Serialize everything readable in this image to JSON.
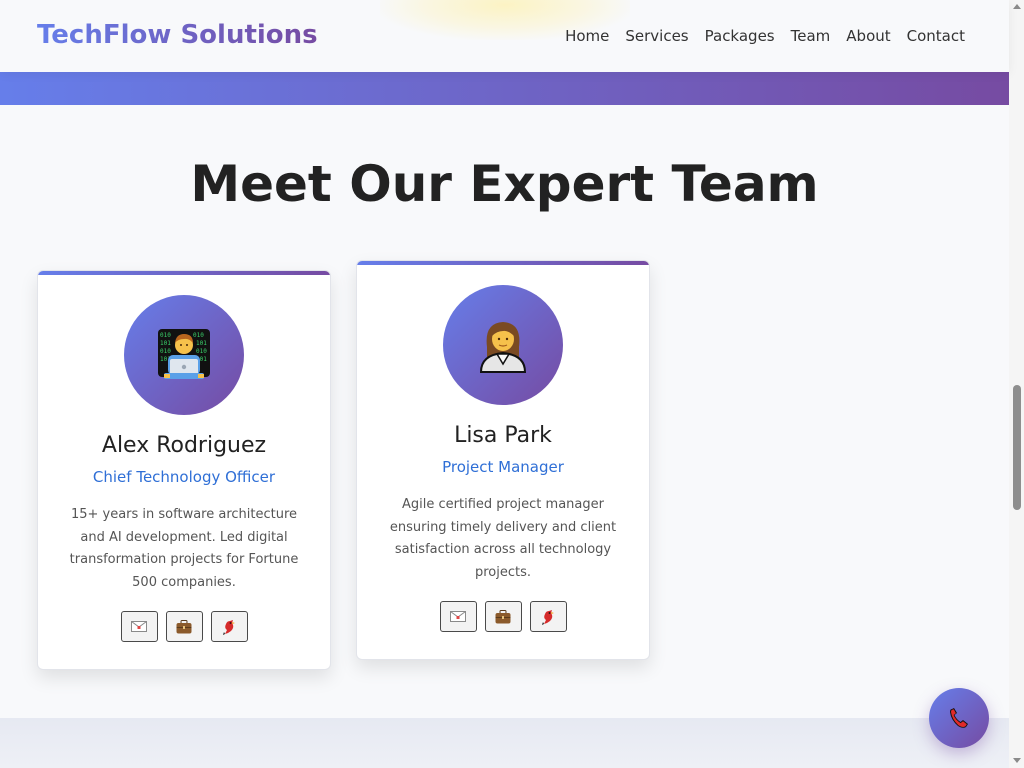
{
  "brand": {
    "name": "TechFlow Solutions"
  },
  "nav": {
    "items": [
      "Home",
      "Services",
      "Packages",
      "Team",
      "About",
      "Contact"
    ]
  },
  "team": {
    "title": "Meet Our Expert Team",
    "members": [
      {
        "avatar_icon": "technologist-icon",
        "name": "Alex Rodriguez",
        "role": "Chief Technology Officer",
        "bio": "15+ years in software architecture and AI development. Led digital transformation projects for Fortune 500 companies.",
        "social_icons": [
          "envelope-icon",
          "briefcase-icon",
          "bird-icon"
        ]
      },
      {
        "avatar_icon": "businesswoman-icon",
        "name": "Lisa Park",
        "role": "Project Manager",
        "bio": "Agile certified project manager ensuring timely delivery and client satisfaction across all technology projects.",
        "social_icons": [
          "envelope-icon",
          "briefcase-icon",
          "bird-icon"
        ]
      }
    ]
  },
  "floating_call": {
    "icon": "phone-icon"
  },
  "colors": {
    "gradient_start": "#667eea",
    "gradient_end": "#764ba2",
    "role_blue": "#2f6fd6"
  }
}
